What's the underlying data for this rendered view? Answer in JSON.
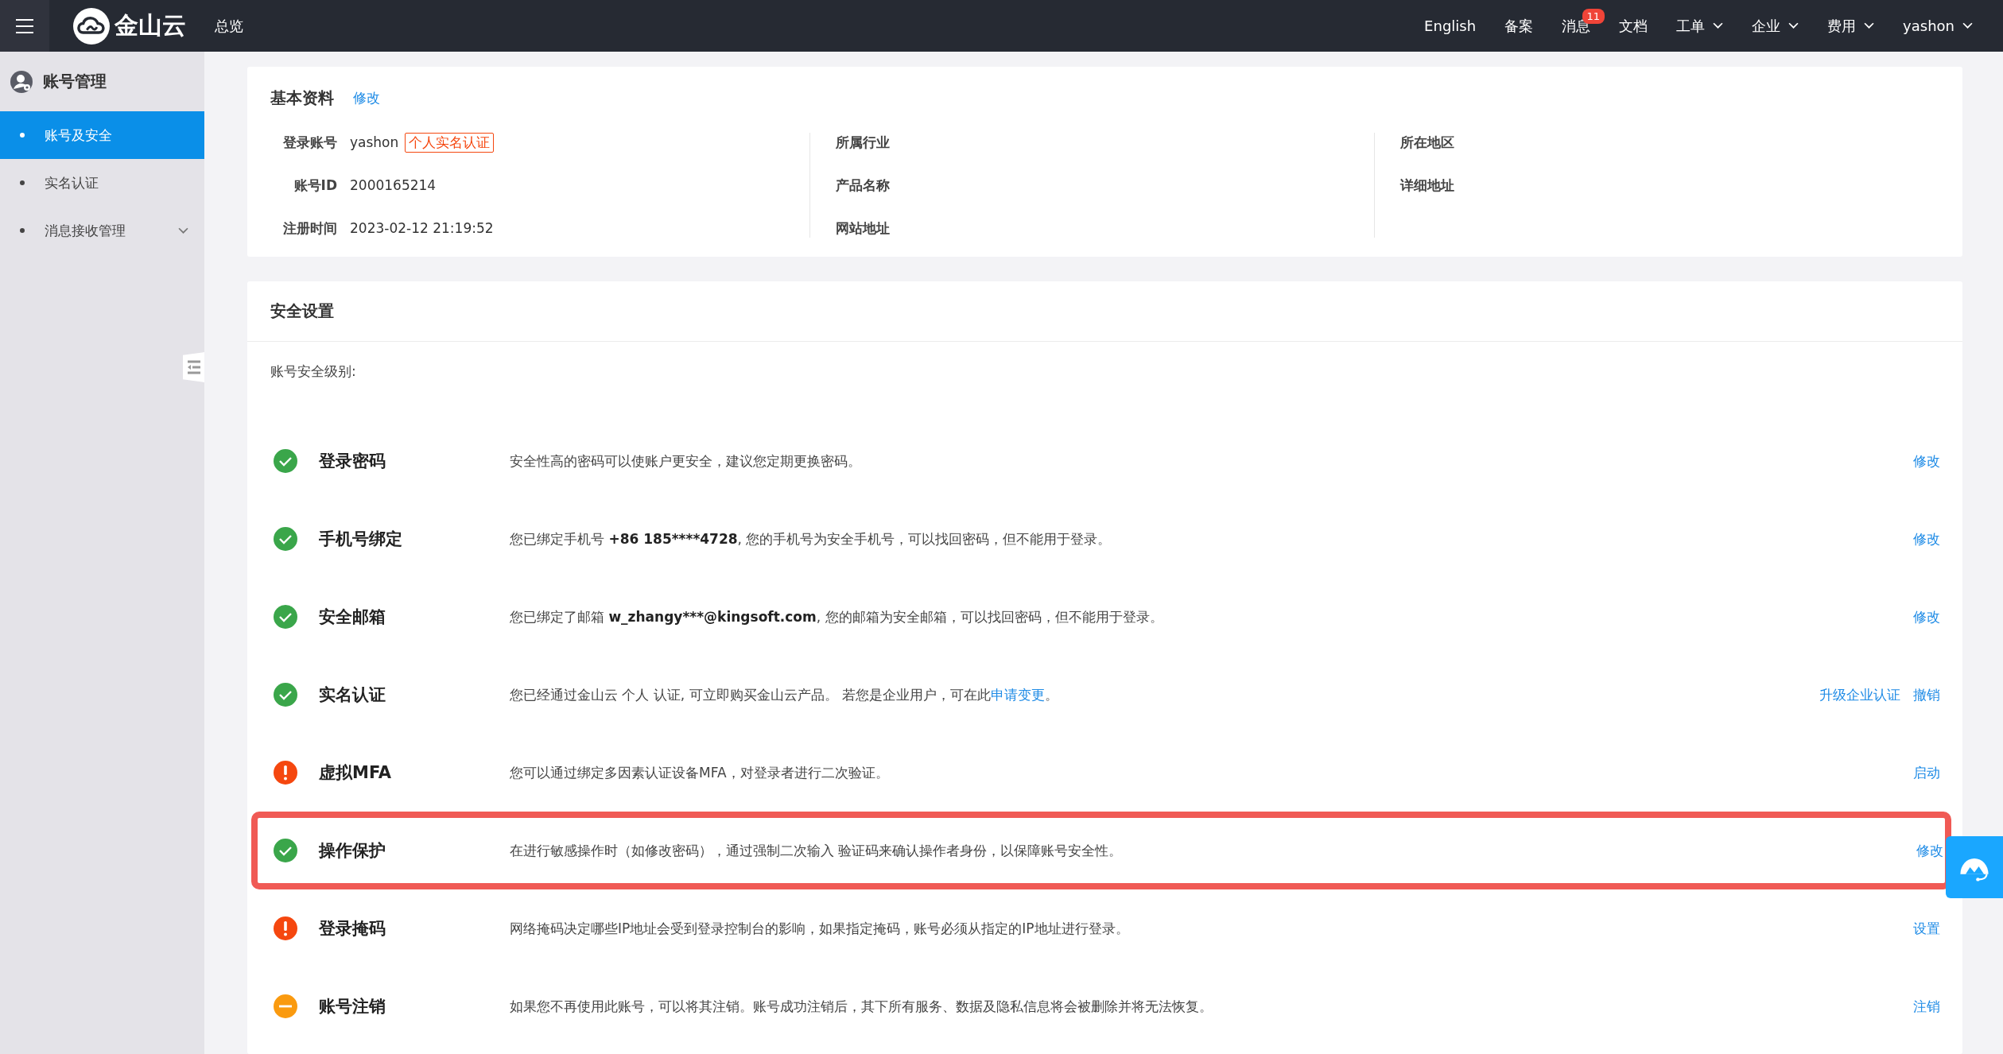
{
  "topbar": {
    "logo": "金山云",
    "nav_left": "总览",
    "nav_right": [
      {
        "label": "English",
        "dropdown": false
      },
      {
        "label": "备案",
        "dropdown": false
      },
      {
        "label": "消息",
        "dropdown": false,
        "badge": "11"
      },
      {
        "label": "文档",
        "dropdown": false
      },
      {
        "label": "工单",
        "dropdown": true
      },
      {
        "label": "企业",
        "dropdown": true
      },
      {
        "label": "费用",
        "dropdown": true
      },
      {
        "label": "yashon",
        "dropdown": true
      }
    ]
  },
  "sidebar": {
    "title": "账号管理",
    "items": [
      {
        "label": "账号及安全",
        "selected": true,
        "expandable": false
      },
      {
        "label": "实名认证",
        "selected": false,
        "expandable": false
      },
      {
        "label": "消息接收管理",
        "selected": false,
        "expandable": true
      }
    ]
  },
  "basic_info": {
    "title": "基本资料",
    "edit_link": "修改",
    "columns": [
      {
        "fields": [
          {
            "label": "登录账号",
            "value": "yashon",
            "tag": "个人实名认证"
          },
          {
            "label": "账号ID",
            "value": "2000165214"
          },
          {
            "label": "注册时间",
            "value": "2023-02-12 21:19:52"
          }
        ]
      },
      {
        "fields": [
          {
            "label": "所属行业"
          },
          {
            "label": "产品名称"
          },
          {
            "label": "网站地址"
          }
        ]
      },
      {
        "fields": [
          {
            "label": "所在地区"
          },
          {
            "label": "详细地址"
          }
        ]
      }
    ]
  },
  "security": {
    "title": "安全设置",
    "level_label": "账号安全级别:",
    "items": [
      {
        "kind": "ok",
        "title": "登录密码",
        "description": "安全性高的密码可以使账户更安全，建议您定期更换密码。",
        "actions": [
          "修改"
        ],
        "highlighted": false
      },
      {
        "kind": "ok",
        "title": "手机号绑定",
        "description": "您已绑定手机号 ",
        "emphasis": "+86 185****4728",
        "description_end": ", 您的手机号为安全手机号，可以找回密码，但不能用于登录。",
        "actions": [
          "修改"
        ],
        "highlighted": false
      },
      {
        "kind": "ok",
        "title": "安全邮箱",
        "description": "您已绑定了邮箱 ",
        "emphasis": "w_zhangy***@kingsoft.com",
        "description_end": ", 您的邮箱为安全邮箱，可以找回密码，但不能用于登录。",
        "actions": [
          "修改"
        ],
        "highlighted": false
      },
      {
        "kind": "ok",
        "title": "实名认证",
        "description": "您已经通过金山云 个人 认证, 可立即购买金山云产品。 若您是企业用户，可在此",
        "link": "申请变更",
        "description_end": "。",
        "actions": [
          "升级企业认证",
          "撤销"
        ],
        "highlighted": false
      },
      {
        "kind": "warning",
        "title": "虚拟MFA",
        "description": "您可以通过绑定多因素认证设备MFA，对登录者进行二次验证。",
        "actions": [
          "启动"
        ],
        "highlighted": false
      },
      {
        "kind": "ok",
        "title": "操作保护",
        "description": "在进行敏感操作时（如修改密码），通过强制二次输入 验证码来确认操作者身份，以保障账号安全性。",
        "actions": [
          "修改"
        ],
        "highlighted": true
      },
      {
        "kind": "warning",
        "title": "登录掩码",
        "description": "网络掩码决定哪些IP地址会受到登录控制台的影响，如果指定掩码，账号必须从指定的IP地址进行登录。",
        "actions": [
          "设置"
        ],
        "highlighted": false
      },
      {
        "kind": "pending",
        "title": "账号注销",
        "description": "如果您不再使用此账号，可以将其注销。账号成功注销后，其下所有服务、数据及隐私信息将会被删除并将无法恢复。",
        "actions": [
          "注销"
        ],
        "highlighted": false
      }
    ]
  }
}
